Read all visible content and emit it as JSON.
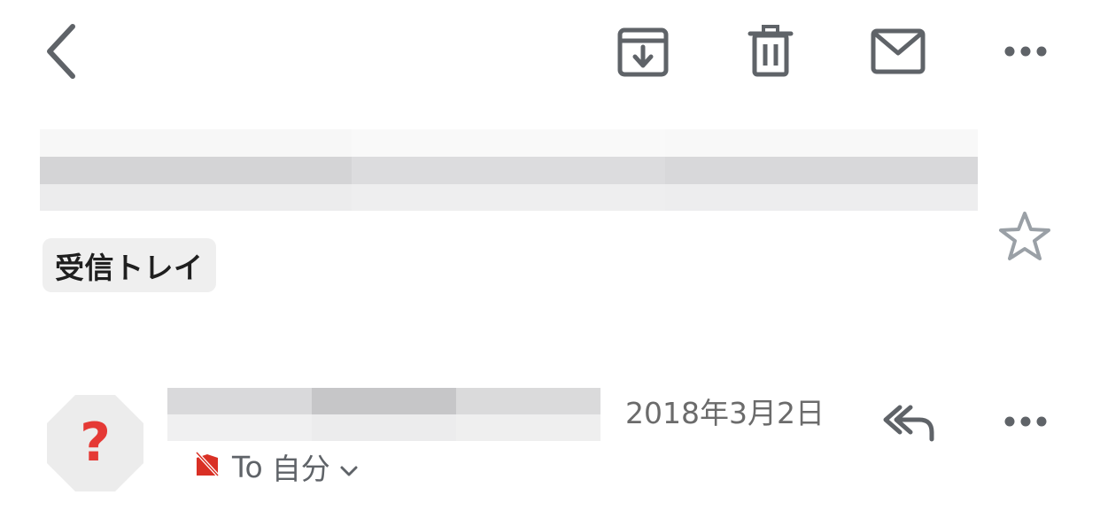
{
  "toolbar": {
    "back": {
      "icon": "chevron-left-icon"
    },
    "archive": {
      "icon": "archive-icon"
    },
    "delete": {
      "icon": "trash-icon"
    },
    "mark_unread": {
      "icon": "mail-icon"
    },
    "more": {
      "icon": "more-horizontal-icon"
    }
  },
  "message": {
    "subject_redacted": true,
    "label": "受信トレイ",
    "starred": false,
    "star_icon": "star-outline-icon"
  },
  "sender": {
    "avatar_icon": "question-mark-icon",
    "name_redacted": true,
    "date": "2018年3月2日",
    "recipient_prefix": "To",
    "recipient": "自分",
    "importance_icon": "important-off-icon",
    "expand_icon": "chevron-down-icon",
    "reply_all_icon": "reply-all-icon",
    "more_icon": "more-horizontal-icon"
  },
  "colors": {
    "icon_gray": "#5f6368",
    "star_gray": "#9aa0a6",
    "avatar_bg": "#ececec",
    "avatar_mark": "#e53935",
    "importance_red": "#d93025",
    "label_bg": "#efefef",
    "date_gray": "#6b6b6b"
  }
}
